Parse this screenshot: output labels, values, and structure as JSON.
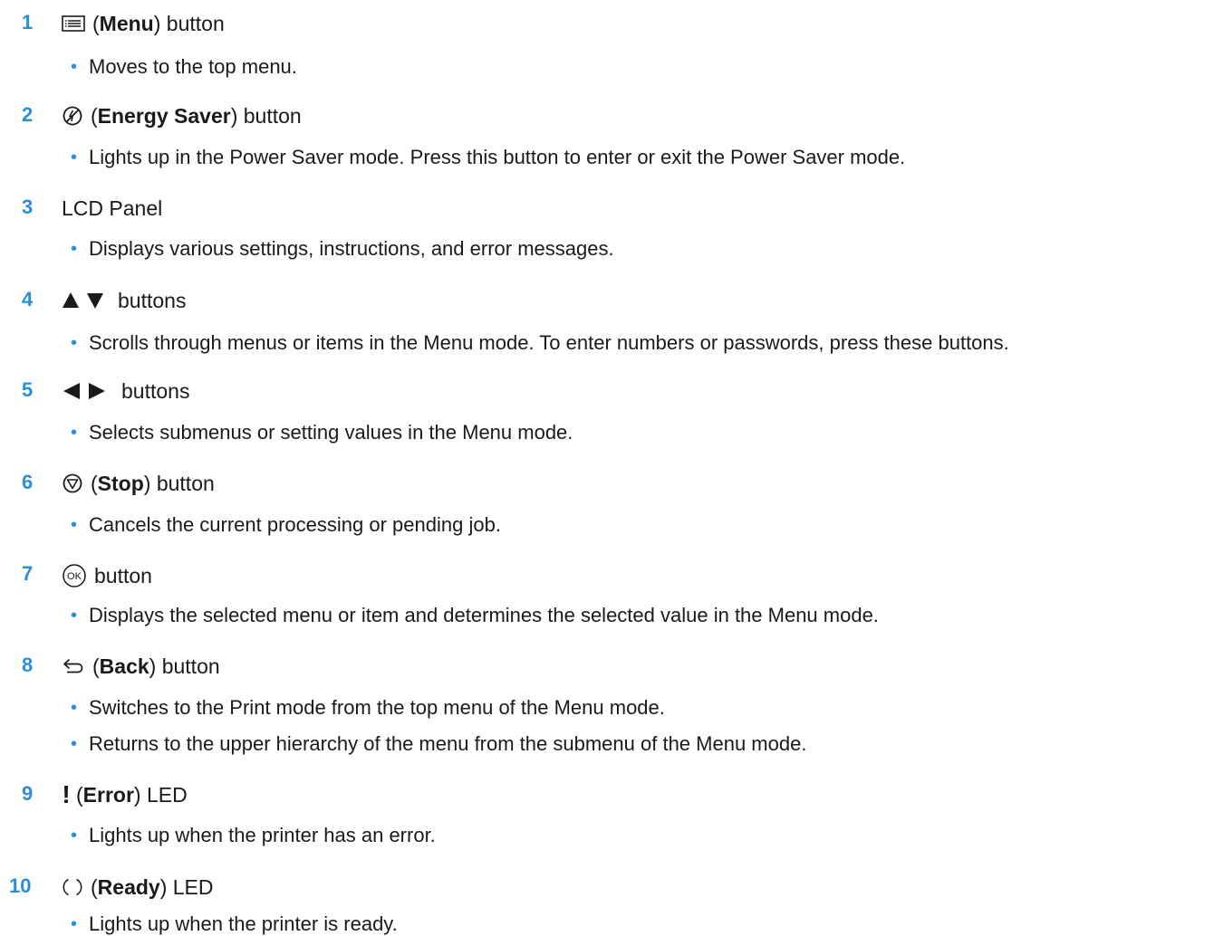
{
  "items": [
    {
      "num": "1",
      "pre": "(",
      "bold": "Menu",
      "post": ") button",
      "icon": "menu-icon",
      "bullets": [
        "Moves to the top menu."
      ]
    },
    {
      "num": "2",
      "pre": "(",
      "bold": "Energy Saver",
      "post": ") button",
      "icon": "energy-saver-icon",
      "bullets": [
        "Lights up in the Power Saver mode. Press this button to enter or exit the Power Saver mode."
      ]
    },
    {
      "num": "3",
      "pre": "",
      "bold": "",
      "post": "LCD Panel",
      "icon": "",
      "bullets": [
        "Displays various settings, instructions, and error messages."
      ]
    },
    {
      "num": "4",
      "pre": "",
      "bold": "",
      "post": "buttons",
      "icon": "up-down-arrows-icon",
      "bullets": [
        "Scrolls through menus or items in the Menu mode. To enter numbers or passwords, press these buttons."
      ]
    },
    {
      "num": "5",
      "pre": "",
      "bold": "",
      "post": "buttons",
      "icon": "left-right-arrows-icon",
      "bullets": [
        "Selects submenus or setting values in the Menu mode."
      ]
    },
    {
      "num": "6",
      "pre": "(",
      "bold": "Stop",
      "post": ") button",
      "icon": "stop-icon",
      "bullets": [
        "Cancels the current processing or pending job."
      ]
    },
    {
      "num": "7",
      "pre": "",
      "bold": "",
      "post": "button",
      "icon": "ok-icon",
      "bullets": [
        "Displays the selected menu or item and determines the selected value in the Menu mode."
      ]
    },
    {
      "num": "8",
      "pre": "(",
      "bold": "Back",
      "post": ") button",
      "icon": "back-icon",
      "bullets": [
        "Switches to the Print mode from the top menu of the Menu mode.",
        "Returns to the upper hierarchy of the menu from the submenu of the Menu mode."
      ]
    },
    {
      "num": "9",
      "pre": "(",
      "bold": "Error",
      "post": ") LED",
      "icon": "error-icon",
      "bullets": [
        "Lights up when the printer has an error."
      ]
    },
    {
      "num": "10",
      "pre": "(",
      "bold": "Ready",
      "post": ") LED",
      "icon": "ready-icon",
      "bullets": [
        "Lights up when the printer is ready."
      ]
    }
  ],
  "ok_icon_text": "OK",
  "error_icon_text": "!",
  "colors": {
    "accent": "#2a8fd6",
    "text": "#1a1a1a"
  }
}
